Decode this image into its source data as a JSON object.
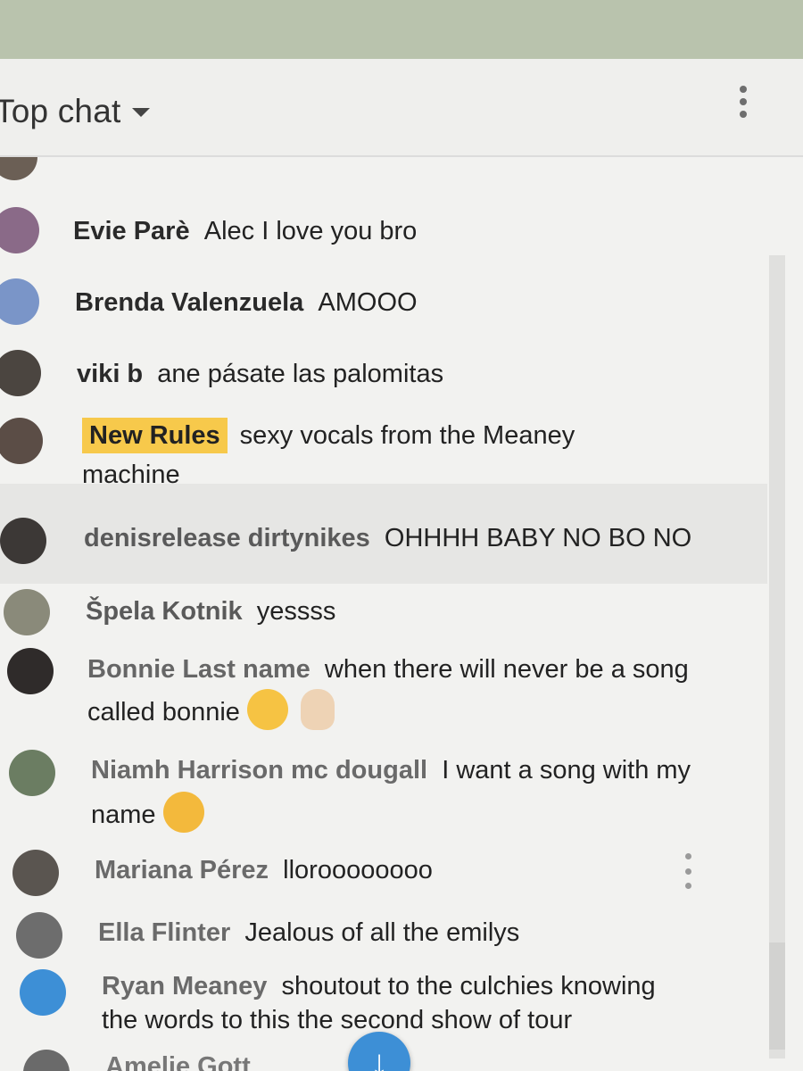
{
  "header": {
    "title": "Top chat"
  },
  "messages": [
    {
      "author": "Evie Parè",
      "text": "Alec I love you bro"
    },
    {
      "author": "Brenda Valenzuela",
      "text": "AMOOO"
    },
    {
      "author": "viki b",
      "text": "ane pásate las palomitas"
    },
    {
      "author": "New Rules",
      "text": "sexy vocals from the Meaney",
      "text2": "machine"
    },
    {
      "author": "denisrelease dirtynikes",
      "text": "OHHHH BABY NO BO NO"
    },
    {
      "author": "Špela Kotnik",
      "text": "yessss"
    },
    {
      "author": "Bonnie Last name",
      "text": "when there will never be a song",
      "text2": "called bonnie"
    },
    {
      "author": "Niamh Harrison mc dougall",
      "text": "I want a song with my",
      "text2": "name"
    },
    {
      "author": "Mariana Pérez",
      "text": "lloroooooooo"
    },
    {
      "author": "Ella Flinter",
      "text": "Jealous of all the emilys"
    },
    {
      "author": "Ryan Meaney",
      "text": "shoutout to the culchies knowing",
      "text2": "the words to this the second show of tour"
    },
    {
      "author": "Amelie Gott",
      "text": ""
    }
  ],
  "icons": {
    "jump": "arrow-down-icon",
    "more": "more-vert-icon"
  },
  "colors": {
    "badge": "#f7c94b",
    "accent_blue": "#3d8fd6"
  }
}
